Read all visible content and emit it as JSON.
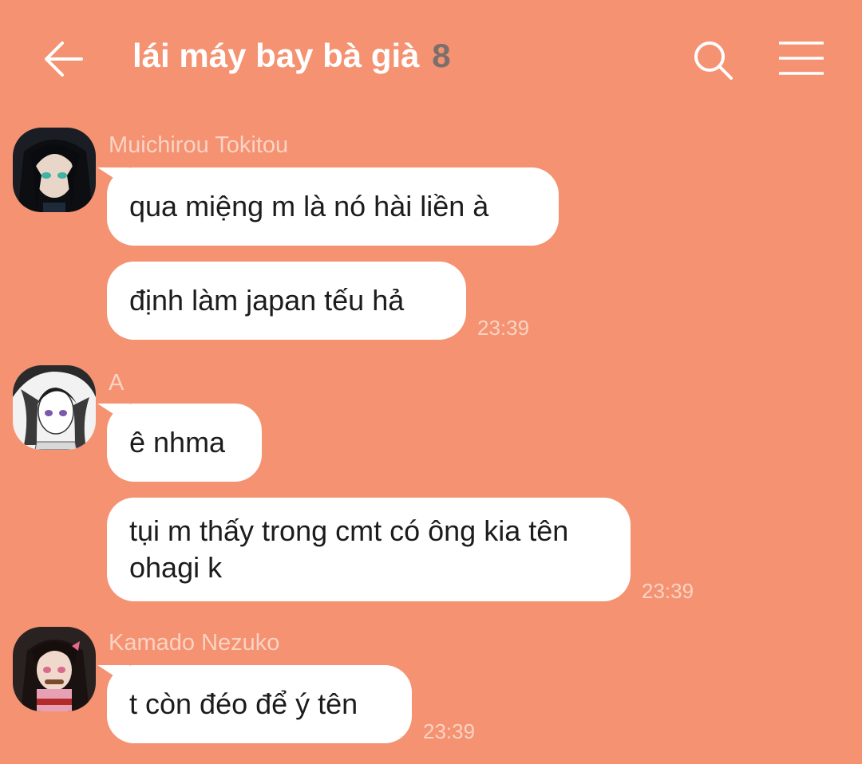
{
  "header": {
    "title": "lái máy bay bà già",
    "member_count": "8",
    "back_icon": "arrow-left-icon",
    "search_icon": "search-icon",
    "menu_icon": "hamburger-menu-icon"
  },
  "messages": [
    {
      "sender": "Muichirou Tokitou",
      "bubbles": [
        "qua miệng m là nó hài liền à",
        "định làm japan tếu hả"
      ],
      "time": "23:39"
    },
    {
      "sender": "A",
      "bubbles": [
        "ê nhma",
        "tụi m thấy trong cmt có ông kia tên ohagi k"
      ],
      "time": "23:39"
    },
    {
      "sender": "Kamado Nezuko",
      "bubbles": [
        "t còn đéo để ý tên"
      ],
      "time": "23:39"
    }
  ],
  "colors": {
    "background": "#f49272",
    "bubble": "#ffffff",
    "meta_text": "#fbd3c3",
    "count_text": "#7b6f6c"
  }
}
